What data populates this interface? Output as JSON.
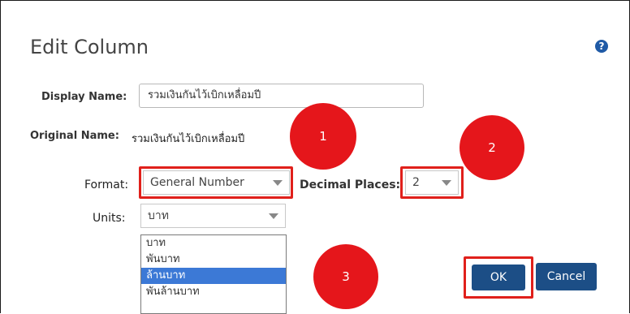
{
  "dialog": {
    "title": "Edit Column",
    "help_icon": "question-circle-icon",
    "help_glyph": "?"
  },
  "display_name": {
    "label": "Display Name:",
    "value": "รวมเงินกันไว้เบิกเหลื่อมปี"
  },
  "original_name": {
    "label": "Original Name:",
    "value": "รวมเงินกันไว้เบิกเหลื่อมปี"
  },
  "format": {
    "label": "Format:",
    "selected": "General Number"
  },
  "decimal_places": {
    "label": "Decimal Places:",
    "selected": "2"
  },
  "units": {
    "label": "Units:",
    "selected": "บาท",
    "options": [
      "บาท",
      "พันบาท",
      "ล้านบาท",
      "พันล้านบาท"
    ],
    "highlighted_index": 2
  },
  "callouts": [
    "1",
    "2",
    "3"
  ],
  "buttons": {
    "ok": "OK",
    "cancel": "Cancel"
  },
  "colors": {
    "callout": "#e5161b",
    "button": "#1c4e86",
    "highlight": "#3c79d6"
  }
}
